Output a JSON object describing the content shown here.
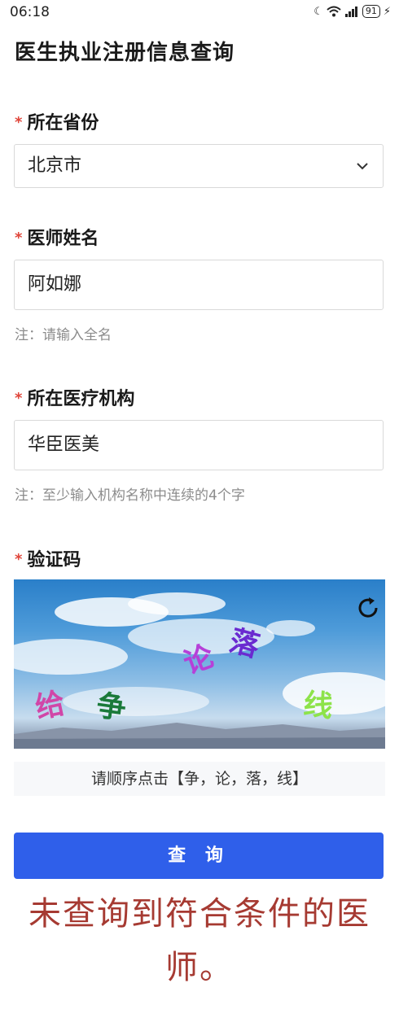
{
  "status_bar": {
    "time": "06:18",
    "battery": "91"
  },
  "page_title": "医生执业注册信息查询",
  "form": {
    "required_mark": "*",
    "province": {
      "label": "所在省份",
      "value": "北京市"
    },
    "name": {
      "label": "医师姓名",
      "value": "阿如娜",
      "note": "注：请输入全名"
    },
    "institution": {
      "label": "所在医疗机构",
      "value": "华臣医美",
      "note": "注：至少输入机构名称中连续的4个字"
    },
    "captcha": {
      "label": "验证码",
      "chars": [
        "给",
        "争",
        "论",
        "落",
        "线"
      ],
      "char_colors": [
        "#d146a8",
        "#1a7a3a",
        "#b640d8",
        "#6a2ad0",
        "#8de34a"
      ],
      "hint": "请顺序点击【争，论，落，线】"
    }
  },
  "query_button": "查 询",
  "result_message": "未查询到符合条件的医师。",
  "icons": {
    "refresh": "refresh-icon",
    "chevron": "chevron-down-icon"
  }
}
